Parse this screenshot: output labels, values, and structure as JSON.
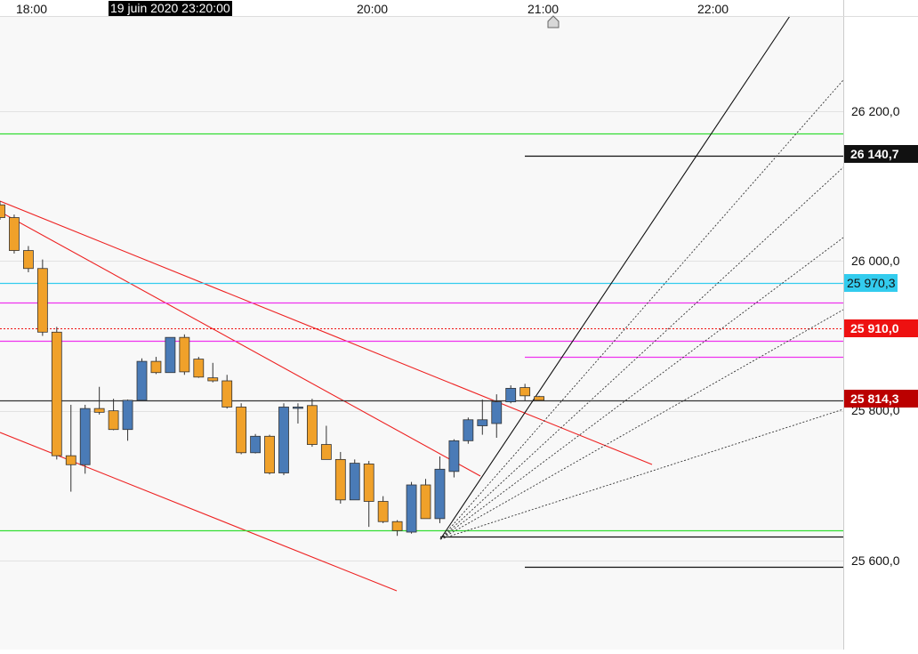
{
  "time_axis": {
    "labels": [
      "18:00",
      "20:00",
      "21:00",
      "22:00"
    ],
    "cursor_label": "19 juin 2020 23:20:00"
  },
  "price_axis": {
    "labels": [
      "26 200,0",
      "26 000,0",
      "25 800,0",
      "25 600,0"
    ]
  },
  "price_tags": {
    "black": "26 140,7",
    "cyan": "25 970,3",
    "red": "25 910,0",
    "dark_red": "25 814,3"
  },
  "colors": {
    "bull": "#4a7bb7",
    "bear": "#f0a12a",
    "green_line": "#33dd33",
    "cyan_line": "#33ccee",
    "magenta_line": "#ee33ee",
    "red_line": "#ee2222"
  },
  "chart_data": {
    "type": "candlestick",
    "title": "",
    "xlabel": "",
    "ylabel": "",
    "interval_minutes": 10,
    "ylim": [
      25480,
      26340
    ],
    "grid": true,
    "candles": [
      {
        "open": 26075,
        "high": 26080,
        "low": 26055,
        "close": 26058
      },
      {
        "open": 26058,
        "high": 26062,
        "low": 26010,
        "close": 26014
      },
      {
        "open": 26014,
        "high": 26020,
        "low": 25985,
        "close": 25990
      },
      {
        "open": 25990,
        "high": 26002,
        "low": 25900,
        "close": 25905
      },
      {
        "open": 25905,
        "high": 25912,
        "low": 25735,
        "close": 25740
      },
      {
        "open": 25740,
        "high": 25808,
        "low": 25692,
        "close": 25728
      },
      {
        "open": 25728,
        "high": 25808,
        "low": 25716,
        "close": 25803
      },
      {
        "open": 25803,
        "high": 25832,
        "low": 25795,
        "close": 25798
      },
      {
        "open": 25800,
        "high": 25816,
        "low": 25774,
        "close": 25775
      },
      {
        "open": 25775,
        "high": 25815,
        "low": 25760,
        "close": 25814
      },
      {
        "open": 25814,
        "high": 25870,
        "low": 25814,
        "close": 25866
      },
      {
        "open": 25866,
        "high": 25872,
        "low": 25849,
        "close": 25851
      },
      {
        "open": 25851,
        "high": 25898,
        "low": 25851,
        "close": 25898
      },
      {
        "open": 25898,
        "high": 25902,
        "low": 25848,
        "close": 25852
      },
      {
        "open": 25869,
        "high": 25872,
        "low": 25844,
        "close": 25845
      },
      {
        "open": 25844,
        "high": 25864,
        "low": 25838,
        "close": 25840
      },
      {
        "open": 25840,
        "high": 25848,
        "low": 25803,
        "close": 25805
      },
      {
        "open": 25805,
        "high": 25810,
        "low": 25742,
        "close": 25744
      },
      {
        "open": 25744,
        "high": 25769,
        "low": 25743,
        "close": 25766
      },
      {
        "open": 25766,
        "high": 25768,
        "low": 25715,
        "close": 25717
      },
      {
        "open": 25717,
        "high": 25810,
        "low": 25714,
        "close": 25805
      },
      {
        "open": 25805,
        "high": 25810,
        "low": 25783,
        "close": 25805
      },
      {
        "open": 25807,
        "high": 25816,
        "low": 25752,
        "close": 25755
      },
      {
        "open": 25755,
        "high": 25780,
        "low": 25744,
        "close": 25735
      },
      {
        "open": 25735,
        "high": 25745,
        "low": 25676,
        "close": 25681
      },
      {
        "open": 25681,
        "high": 25735,
        "low": 25681,
        "close": 25730
      },
      {
        "open": 25729,
        "high": 25733,
        "low": 25645,
        "close": 25679
      },
      {
        "open": 25679,
        "high": 25686,
        "low": 25650,
        "close": 25652
      },
      {
        "open": 25652,
        "high": 25654,
        "low": 25633,
        "close": 25640
      },
      {
        "open": 25638,
        "high": 25705,
        "low": 25636,
        "close": 25701
      },
      {
        "open": 25701,
        "high": 25709,
        "low": 25658,
        "close": 25656
      },
      {
        "open": 25656,
        "high": 25739,
        "low": 25650,
        "close": 25722
      },
      {
        "open": 25719,
        "high": 25762,
        "low": 25711,
        "close": 25760
      },
      {
        "open": 25760,
        "high": 25791,
        "low": 25756,
        "close": 25788
      },
      {
        "open": 25780,
        "high": 25815,
        "low": 25768,
        "close": 25788
      },
      {
        "open": 25783,
        "high": 25822,
        "low": 25764,
        "close": 25812
      },
      {
        "open": 25812,
        "high": 25834,
        "low": 25810,
        "close": 25830
      },
      {
        "open": 25831,
        "high": 25836,
        "low": 25813,
        "close": 25820
      },
      {
        "open": 25819,
        "high": 25820,
        "low": 25813,
        "close": 25814
      }
    ],
    "horizontal_levels": [
      {
        "price": 26140.7,
        "color": "#111111",
        "style": "solid"
      },
      {
        "price": 26170,
        "color": "#33dd33",
        "style": "solid"
      },
      {
        "price": 25970.3,
        "color": "#33ccee",
        "style": "solid"
      },
      {
        "price": 25945,
        "color": "#ee33ee",
        "style": "solid"
      },
      {
        "price": 25910,
        "color": "#ee1111",
        "style": "dotted"
      },
      {
        "price": 25894,
        "color": "#ee33ee",
        "style": "solid"
      },
      {
        "price": 25872,
        "color": "#ee33ee",
        "style": "solid"
      },
      {
        "price": 25814.3,
        "color": "#333333",
        "style": "solid"
      },
      {
        "price": 25640,
        "color": "#33dd33",
        "style": "solid"
      },
      {
        "price": 25632,
        "color": "#111111",
        "style": "solid"
      },
      {
        "price": 25592,
        "color": "#111111",
        "style": "solid"
      }
    ]
  }
}
